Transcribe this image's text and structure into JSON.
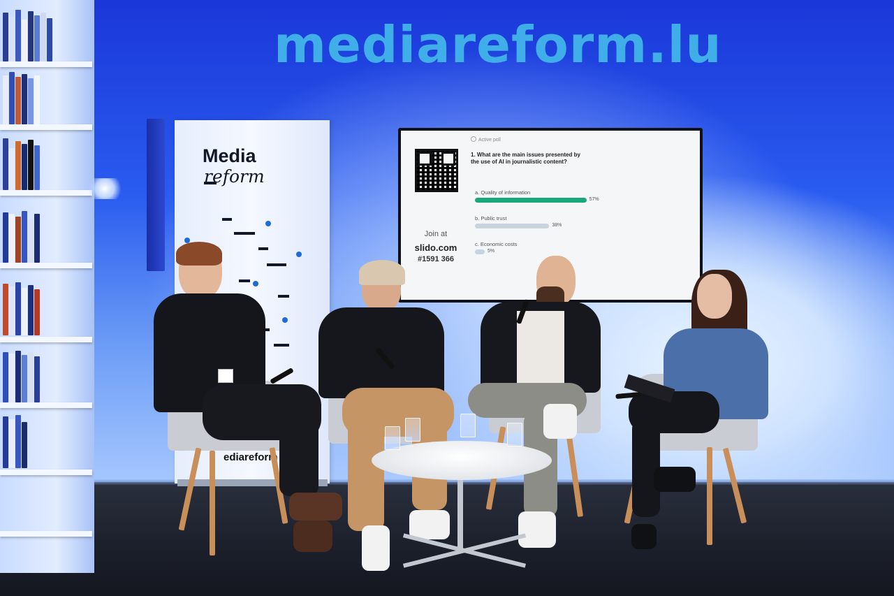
{
  "scene": {
    "backdrop_text": "mediareform.lu",
    "banner": {
      "logo_line1": "Media",
      "logo_line2": "reform",
      "bottom_text": "ediareform"
    },
    "screen": {
      "qr_label": "slido-qr-code",
      "join_label": "Join at",
      "join_site": "slido.com",
      "join_code": "#1591 366",
      "poll_status": "Active poll",
      "question": "1. What are the main issues presented by the use of AI in journalistic content?",
      "options": [
        {
          "label": "a. Quality of information",
          "percent": 57,
          "percent_text": "57%",
          "color": "#1aa87a"
        },
        {
          "label": "b. Public trust",
          "percent": 38,
          "percent_text": "38%",
          "color": "#c7d3df"
        },
        {
          "label": "c. Economic costs",
          "percent": 5,
          "percent_text": "5%",
          "color": "#c7d3df"
        }
      ]
    },
    "colors": {
      "backdrop": "#1d3fd6",
      "title_text": "#43b8ea",
      "floor": "#1b1f2a"
    }
  }
}
